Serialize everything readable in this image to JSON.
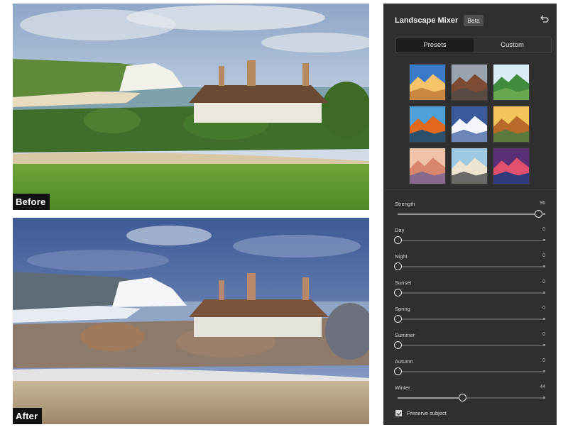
{
  "photos": {
    "before_label": "Before",
    "after_label": "After"
  },
  "panel": {
    "title": "Landscape Mixer",
    "badge": "Beta",
    "reset_icon": "undo-icon",
    "tabs": [
      {
        "label": "Presets",
        "active": true
      },
      {
        "label": "Custom",
        "active": false
      }
    ],
    "presets": [
      {
        "name": "desert-canyon",
        "colors": [
          "#3a78c9",
          "#f4c36a",
          "#c9883e"
        ]
      },
      {
        "name": "monument-valley",
        "colors": [
          "#9aa3ad",
          "#7d4a33",
          "#5a4a44"
        ]
      },
      {
        "name": "green-valley",
        "colors": [
          "#d8ecf5",
          "#3f8c3c",
          "#6aa84f"
        ]
      },
      {
        "name": "sunset-lake",
        "colors": [
          "#4ea0d8",
          "#e2681c",
          "#2c4f6b"
        ]
      },
      {
        "name": "snow-mountain",
        "colors": [
          "#3a5a9c",
          "#f2f5fa",
          "#6d86b8"
        ]
      },
      {
        "name": "golden-canyon",
        "colors": [
          "#f1c55a",
          "#b76a2a",
          "#5b7a3c"
        ]
      },
      {
        "name": "pink-mist",
        "colors": [
          "#f0c3a8",
          "#d8876e",
          "#8a6a8c"
        ]
      },
      {
        "name": "coastal-rocks",
        "colors": [
          "#9fc8e2",
          "#ede4d2",
          "#6b6a66"
        ]
      },
      {
        "name": "purple-dusk",
        "colors": [
          "#5a2f78",
          "#e0506e",
          "#2e3a7a"
        ]
      }
    ],
    "sliders": [
      {
        "label": "Strength",
        "value": "96",
        "fraction": 0.96
      },
      {
        "label": "Day",
        "value": "0",
        "fraction": 0
      },
      {
        "label": "Night",
        "value": "0",
        "fraction": 0
      },
      {
        "label": "Sunset",
        "value": "0",
        "fraction": 0
      },
      {
        "label": "Spring",
        "value": "0",
        "fraction": 0
      },
      {
        "label": "Summer",
        "value": "0",
        "fraction": 0
      },
      {
        "label": "Autumn",
        "value": "0",
        "fraction": 0
      },
      {
        "label": "Winter",
        "value": "44",
        "fraction": 0.44
      }
    ],
    "preserve_subject": {
      "label": "Preserve subject",
      "checked": true
    }
  }
}
